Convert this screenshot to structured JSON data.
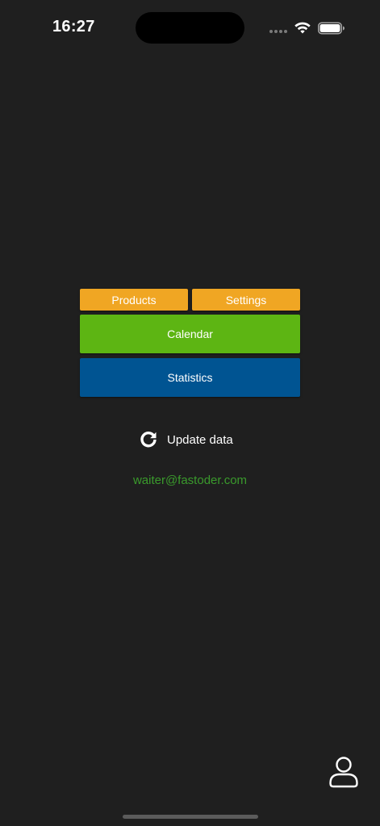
{
  "status_bar": {
    "time": "16:27"
  },
  "icons": {
    "wifi": "wifi-icon",
    "battery": "battery-icon",
    "refresh": "refresh-icon",
    "profile": "user-profile-icon"
  },
  "menu": {
    "products_label": "Products",
    "settings_label": "Settings",
    "calendar_label": "Calendar",
    "statistics_label": "Statistics"
  },
  "update": {
    "label": "Update data"
  },
  "account": {
    "email": "waiter@fastoder.com"
  },
  "colors": {
    "background": "#1f1f1f",
    "products": "#f0a623",
    "settings": "#f0a623",
    "calendar": "#5db513",
    "statistics": "#005492",
    "email": "#3a9a2c"
  }
}
